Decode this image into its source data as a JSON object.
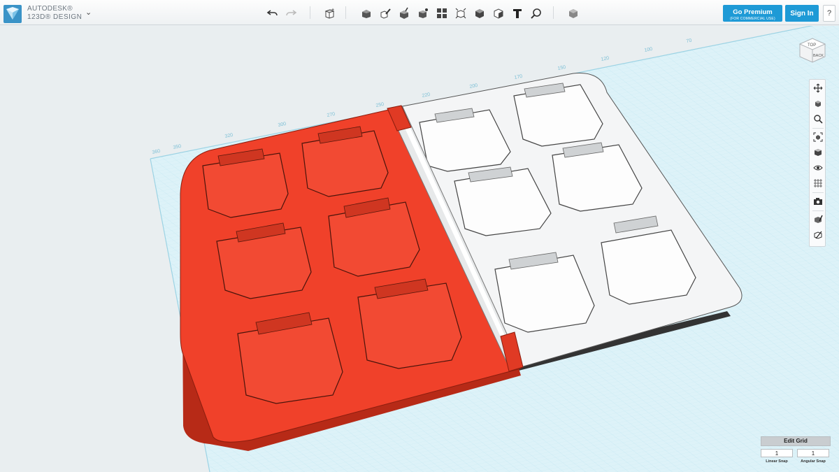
{
  "app": {
    "brand_line1": "AUTODESK®",
    "brand_line2": "123D® DESIGN"
  },
  "icons": {
    "brand_menu": "chevron-down-icon",
    "undo": "undo-icon",
    "redo": "redo-icon",
    "primitives": "primitives-icon",
    "sketch": "sketch-icon",
    "construct": "construct-icon",
    "modify": "modify-icon",
    "pattern": "pattern-icon",
    "grouping": "grouping-icon",
    "combine": "combine-icon",
    "measure": "measure-icon",
    "text": "text-icon",
    "snap": "snap-icon",
    "material": "material-icon"
  },
  "header": {
    "premium_label": "Go Premium",
    "premium_sub": "(FOR COMMERCIAL USE)",
    "signin_label": "Sign In",
    "help_label": "?"
  },
  "viewcube": {
    "top_label": "TOP",
    "back_label": "BACK"
  },
  "ruler": {
    "labels": [
      "360",
      "350",
      "320",
      "300",
      "270",
      "250",
      "220",
      "200",
      "170",
      "150",
      "120",
      "100",
      "70"
    ]
  },
  "grid_panel": {
    "edit_label": "Edit Grid",
    "linear_value": "1",
    "angular_value": "1",
    "linear_label": "Linear Snap",
    "angular_label": "Angular Snap"
  },
  "colors": {
    "accent": "#1e9ad6",
    "red_case": "#f0412a",
    "white_case": "#f4f5f6",
    "grid": "#bfe6f2"
  }
}
